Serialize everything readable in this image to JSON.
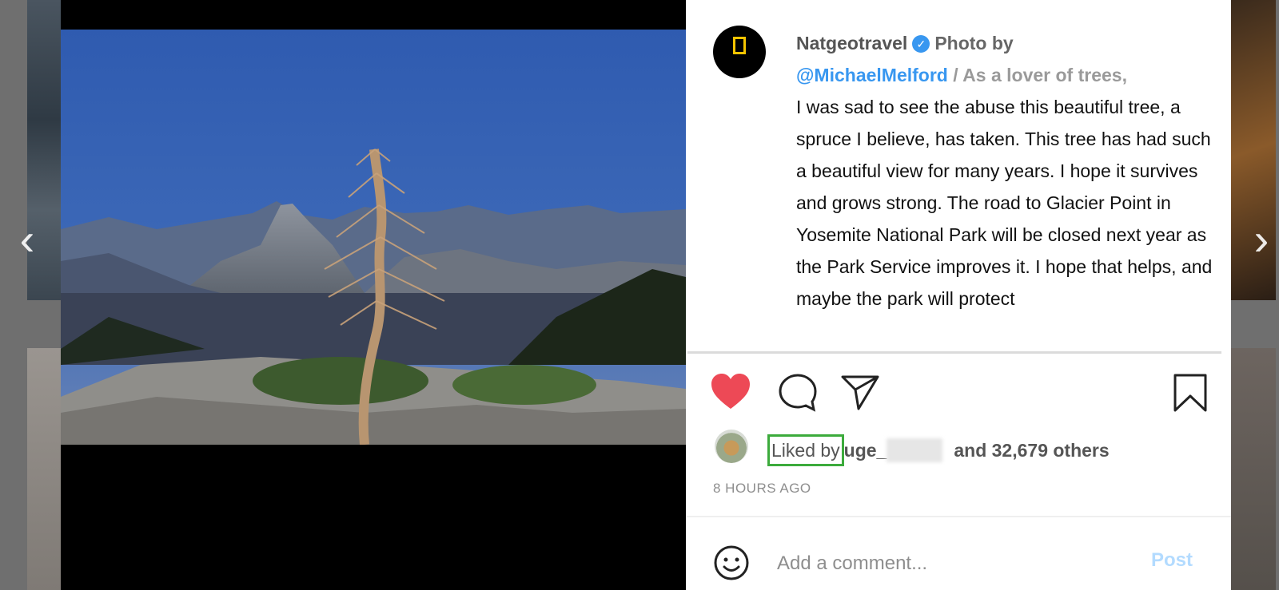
{
  "post": {
    "author": "Natgeotravel",
    "verified_mark": "✓",
    "photo_by_label": "Photo by",
    "mention": "@MichaelMelford",
    "caption_lead": "/ As a lover of trees,",
    "caption_body": "I was sad to see the abuse this beautiful tree, a spruce I believe, has taken. This tree has had such a beautiful view for many years. I hope it survives and grows strong. The road to Glacier Point in Yosemite National Park will be closed next year as the Park Service improves it. I hope that helps, and maybe the park will protect"
  },
  "likes": {
    "liked_by_label": "Liked by",
    "liker_partial": "uge_",
    "others_text": "and 32,679 others"
  },
  "timestamp": "8 HOURS AGO",
  "comment": {
    "placeholder": "Add a comment...",
    "post_label": "Post"
  },
  "icons": {
    "heart": "heart-icon",
    "comment": "comment-icon",
    "share": "share-icon",
    "save": "bookmark-icon",
    "emoji": "smiley-icon",
    "prev": "chevron-left-icon",
    "next": "chevron-right-icon"
  },
  "colors": {
    "like": "#ed4956",
    "link": "#3897f0",
    "highlight": "#3cab3c",
    "post_disabled": "#b3dbff"
  }
}
